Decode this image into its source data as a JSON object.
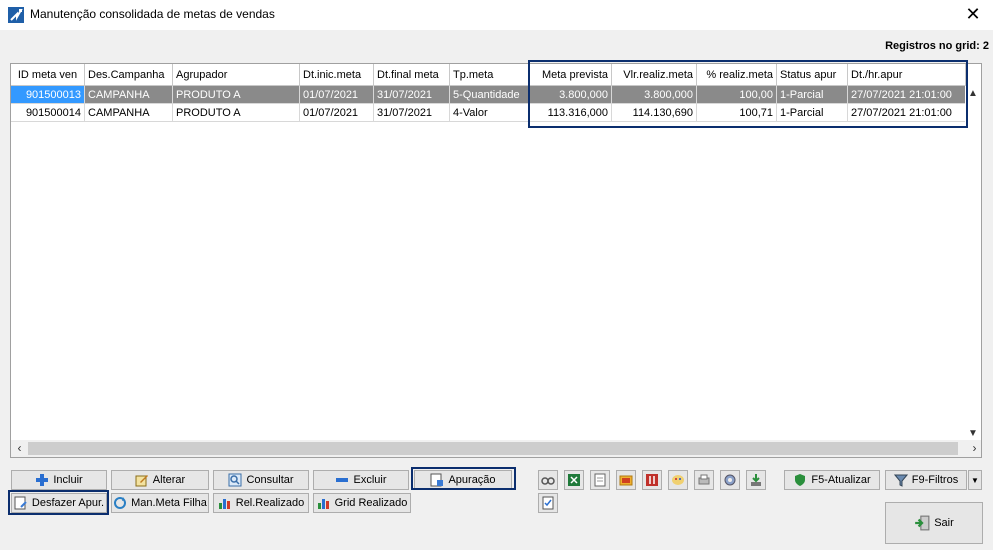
{
  "window": {
    "title": "Manutenção consolidada de metas de vendas",
    "close_symbol": "✕"
  },
  "grid": {
    "record_count_label": "Registros no grid: 2",
    "columns": [
      "ID meta ven",
      "Des.Campanha",
      "Agrupador",
      "Dt.inic.meta",
      "Dt.final meta",
      "Tp.meta",
      "Meta prevista",
      "Vlr.realiz.meta",
      "% realiz.meta",
      "Status apur",
      "Dt./hr.apur"
    ],
    "rows": [
      [
        "901500013",
        "CAMPANHA",
        "PRODUTO A",
        "01/07/2021",
        "31/07/2021",
        "5-Quantidade",
        "3.800,000",
        "3.800,000",
        "100,00",
        "1-Parcial",
        "27/07/2021 21:01:00"
      ],
      [
        "901500014",
        "CAMPANHA",
        "PRODUTO A",
        "01/07/2021",
        "31/07/2021",
        "4-Valor",
        "113.316,000",
        "114.130,690",
        "100,71",
        "1-Parcial",
        "27/07/2021 21:01:00"
      ]
    ],
    "selected_row": 0
  },
  "buttons": {
    "incluir": "Incluir",
    "alterar": "Alterar",
    "consultar": "Consultar",
    "excluir": "Excluir",
    "apuracao": "Apuração",
    "desfazer": "Desfazer Apur.",
    "man_meta_filha": "Man.Meta Filha",
    "rel_realizado": "Rel.Realizado",
    "grid_realizado": "Grid Realizado",
    "atualizar": "F5-Atualizar",
    "filtros": "F9-Filtros",
    "sair": "Sair"
  },
  "icons": [
    "app-icon",
    "plus-icon",
    "edit-icon",
    "search-icon",
    "minus-icon",
    "calc-icon",
    "undo-icon",
    "refresh-icon",
    "bar-chart-icon",
    "grid-chart-icon",
    "glasses-icon",
    "excel-icon",
    "document-icon",
    "folder-icon",
    "sort-icon",
    "palette-icon",
    "print-icon",
    "gear-icon",
    "download-icon",
    "checklist-icon",
    "refresh-shield-icon",
    "filter-icon",
    "exit-icon"
  ],
  "colors": {
    "selection": "#8a8a8a",
    "selection_id": "#3399ff",
    "highlight_border": "#0b2e6e"
  }
}
